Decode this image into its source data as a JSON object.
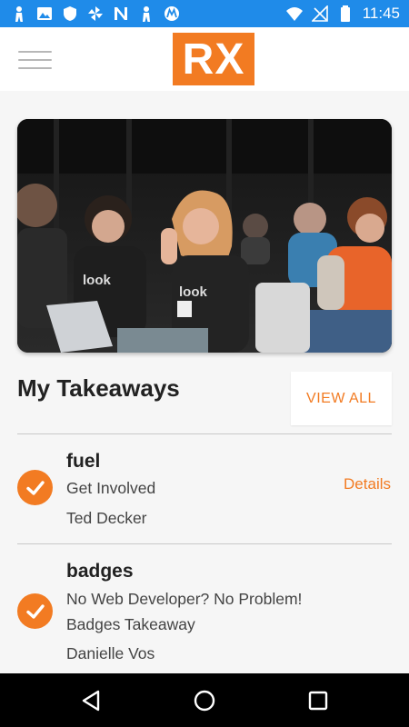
{
  "status_bar": {
    "time": "11:45",
    "icons": [
      "person-icon",
      "image-icon",
      "shield-icon",
      "pinwheel-icon",
      "n-app-icon",
      "person-icon",
      "motorola-icon",
      "wifi-icon",
      "no-sim-icon",
      "battery-icon"
    ]
  },
  "app_bar": {
    "logo_text": "RX",
    "menu_icon": "hamburger-menu-icon",
    "brand_color": "#f27b22"
  },
  "hero": {
    "shirt_text": "look"
  },
  "takeaways": {
    "title": "My Takeaways",
    "view_all_label": "VIEW ALL",
    "items": [
      {
        "title": "fuel",
        "lines": [
          "Get Involved",
          "Ted Decker"
        ],
        "details_label": "Details",
        "icon": "check-circle-icon"
      },
      {
        "title": "badges",
        "lines": [
          "No Web Developer? No Problem!",
          "Badges Takeaway",
          "Danielle Vos"
        ],
        "icon": "check-circle-icon"
      }
    ]
  },
  "nav_bar": {
    "buttons": [
      "back-triangle-icon",
      "home-circle-icon",
      "recents-square-icon"
    ]
  }
}
